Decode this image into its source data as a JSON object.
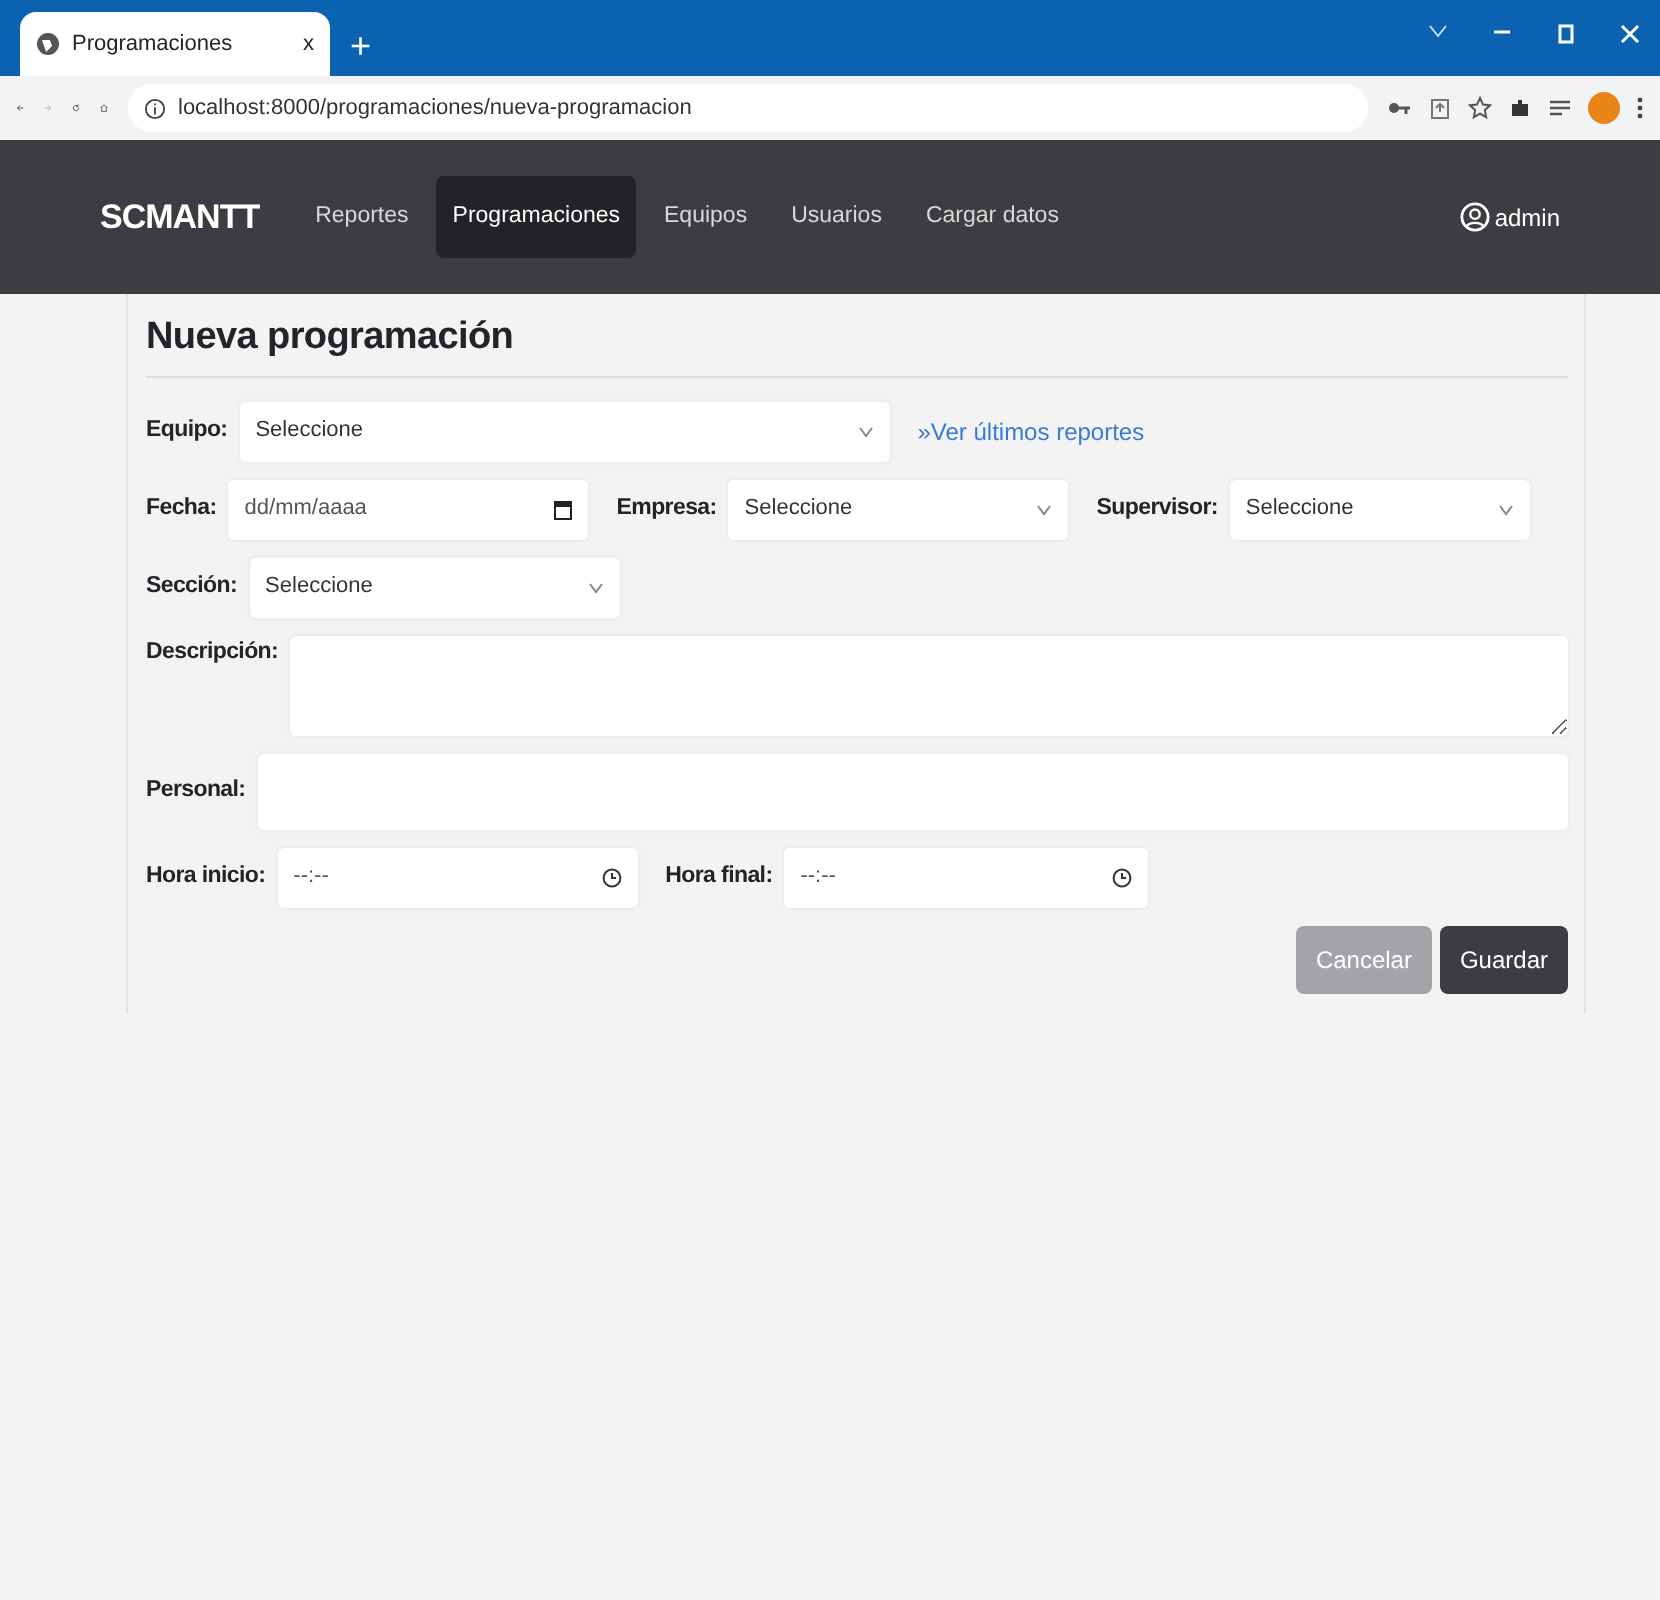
{
  "browser": {
    "tab_title": "Programaciones",
    "tab_close": "x",
    "new_tab": "+",
    "url": "localhost:8000/programaciones/nueva-programacion"
  },
  "navbar": {
    "brand": "SCMANTT",
    "items": [
      {
        "label": "Reportes",
        "selected": false
      },
      {
        "label": "Programaciones",
        "selected": true
      },
      {
        "label": "Equipos",
        "selected": false
      },
      {
        "label": "Usuarios",
        "selected": false
      },
      {
        "label": "Cargar datos",
        "selected": false
      }
    ],
    "user": "admin"
  },
  "form": {
    "title": "Nueva programación",
    "rows": [
      {
        "fields": [
          {
            "kind": "select",
            "label": "Equipo:",
            "value": "Seleccione"
          }
        ],
        "link": "»Ver últimos reportes"
      },
      {
        "fields": [
          {
            "kind": "date",
            "label": "Fecha:",
            "placeholder": "dd/mm/aaaa"
          },
          {
            "kind": "select",
            "label": "Empresa:",
            "value": "Seleccione"
          },
          {
            "kind": "select",
            "label": "Supervisor:",
            "value": "Seleccione"
          }
        ]
      },
      {
        "fields": [
          {
            "kind": "select",
            "label": "Sección:",
            "value": "Seleccione"
          }
        ]
      },
      {
        "fields": [
          {
            "kind": "textarea",
            "label": "Descripción:"
          }
        ]
      },
      {
        "fields": [
          {
            "kind": "text",
            "label": "Personal:"
          }
        ]
      },
      {
        "fields": [
          {
            "kind": "time",
            "label": "Hora inicio:",
            "placeholder": "--:--"
          },
          {
            "kind": "time",
            "label": "Hora final:",
            "placeholder": "--:--"
          }
        ]
      }
    ],
    "buttons": [
      {
        "label": "Cancelar",
        "kind": "secondary"
      },
      {
        "label": "Guardar",
        "kind": "primary"
      }
    ]
  }
}
